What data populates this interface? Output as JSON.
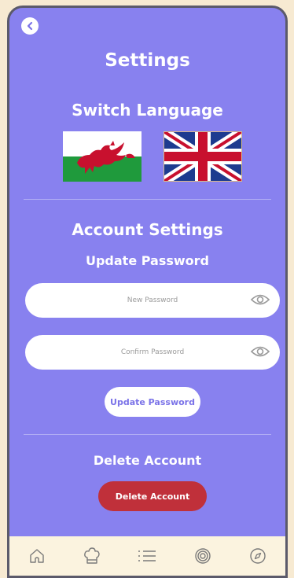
{
  "header": {
    "title": "Settings"
  },
  "language": {
    "heading": "Switch Language",
    "options": [
      "welsh-flag",
      "uk-flag"
    ]
  },
  "account": {
    "heading": "Account Settings",
    "update_heading": "Update Password",
    "new_password_placeholder": "New Password",
    "confirm_password_placeholder": "Confirm Password",
    "update_button": "Update Password",
    "delete_heading": "Delete Account",
    "delete_button": "Delete Account"
  },
  "tabs": [
    "home-icon",
    "chef-hat-icon",
    "list-icon",
    "target-icon",
    "compass-icon"
  ],
  "colors": {
    "background": "#8881ef",
    "delete": "#c0303a",
    "tabbar": "#fbf3df"
  }
}
